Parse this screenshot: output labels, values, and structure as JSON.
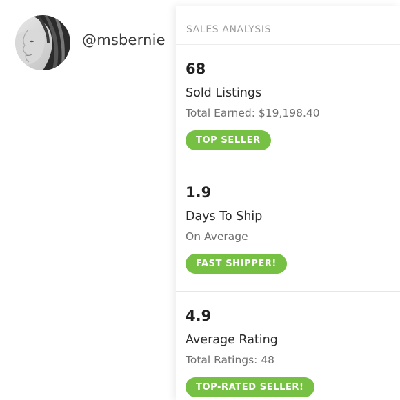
{
  "profile": {
    "username": "@msbernie"
  },
  "sales_analysis": {
    "title": "SALES ANALYSIS",
    "stats": [
      {
        "value": "68",
        "label": "Sold Listings",
        "sub": "Total Earned: $19,198.40",
        "badge": "TOP SELLER"
      },
      {
        "value": "1.9",
        "label": "Days To Ship",
        "sub": "On Average",
        "badge": "FAST SHIPPER!"
      },
      {
        "value": "4.9",
        "label": "Average Rating",
        "sub": "Total Ratings: 48",
        "badge": "TOP-RATED SELLER!"
      }
    ]
  },
  "colors": {
    "badge_green": "#76c043",
    "header_gray": "#9a9a9a"
  }
}
